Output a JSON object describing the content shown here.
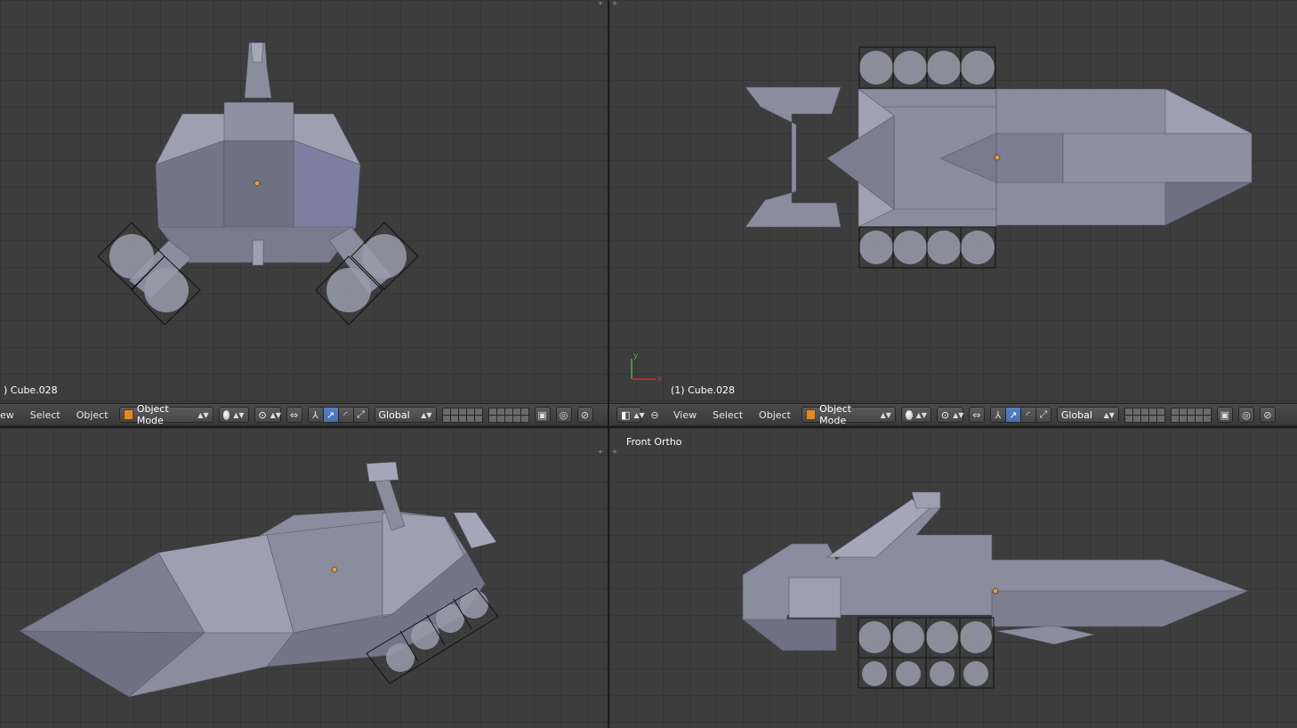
{
  "viewports": {
    "top_left": {
      "object_label": ") Cube.028"
    },
    "top_right": {
      "object_label": "(1) Cube.028"
    },
    "bottom_right": {
      "view_label": "Front Ortho"
    }
  },
  "header_left": {
    "menu_view": "ew",
    "menu_select": "Select",
    "menu_object": "Object",
    "mode": "Object Mode",
    "orientation": "Global"
  },
  "header_right": {
    "menu_view": "View",
    "menu_select": "Select",
    "menu_object": "Object",
    "mode": "Object Mode",
    "orientation": "Global"
  },
  "axis": {
    "y": "y",
    "x": "x"
  },
  "colors": {
    "mesh": "#8b8d9e",
    "mesh_dark": "#6c6e7e",
    "mesh_light": "#a5a7b8",
    "origin": "#e09a48",
    "active_button": "#5680c2"
  }
}
